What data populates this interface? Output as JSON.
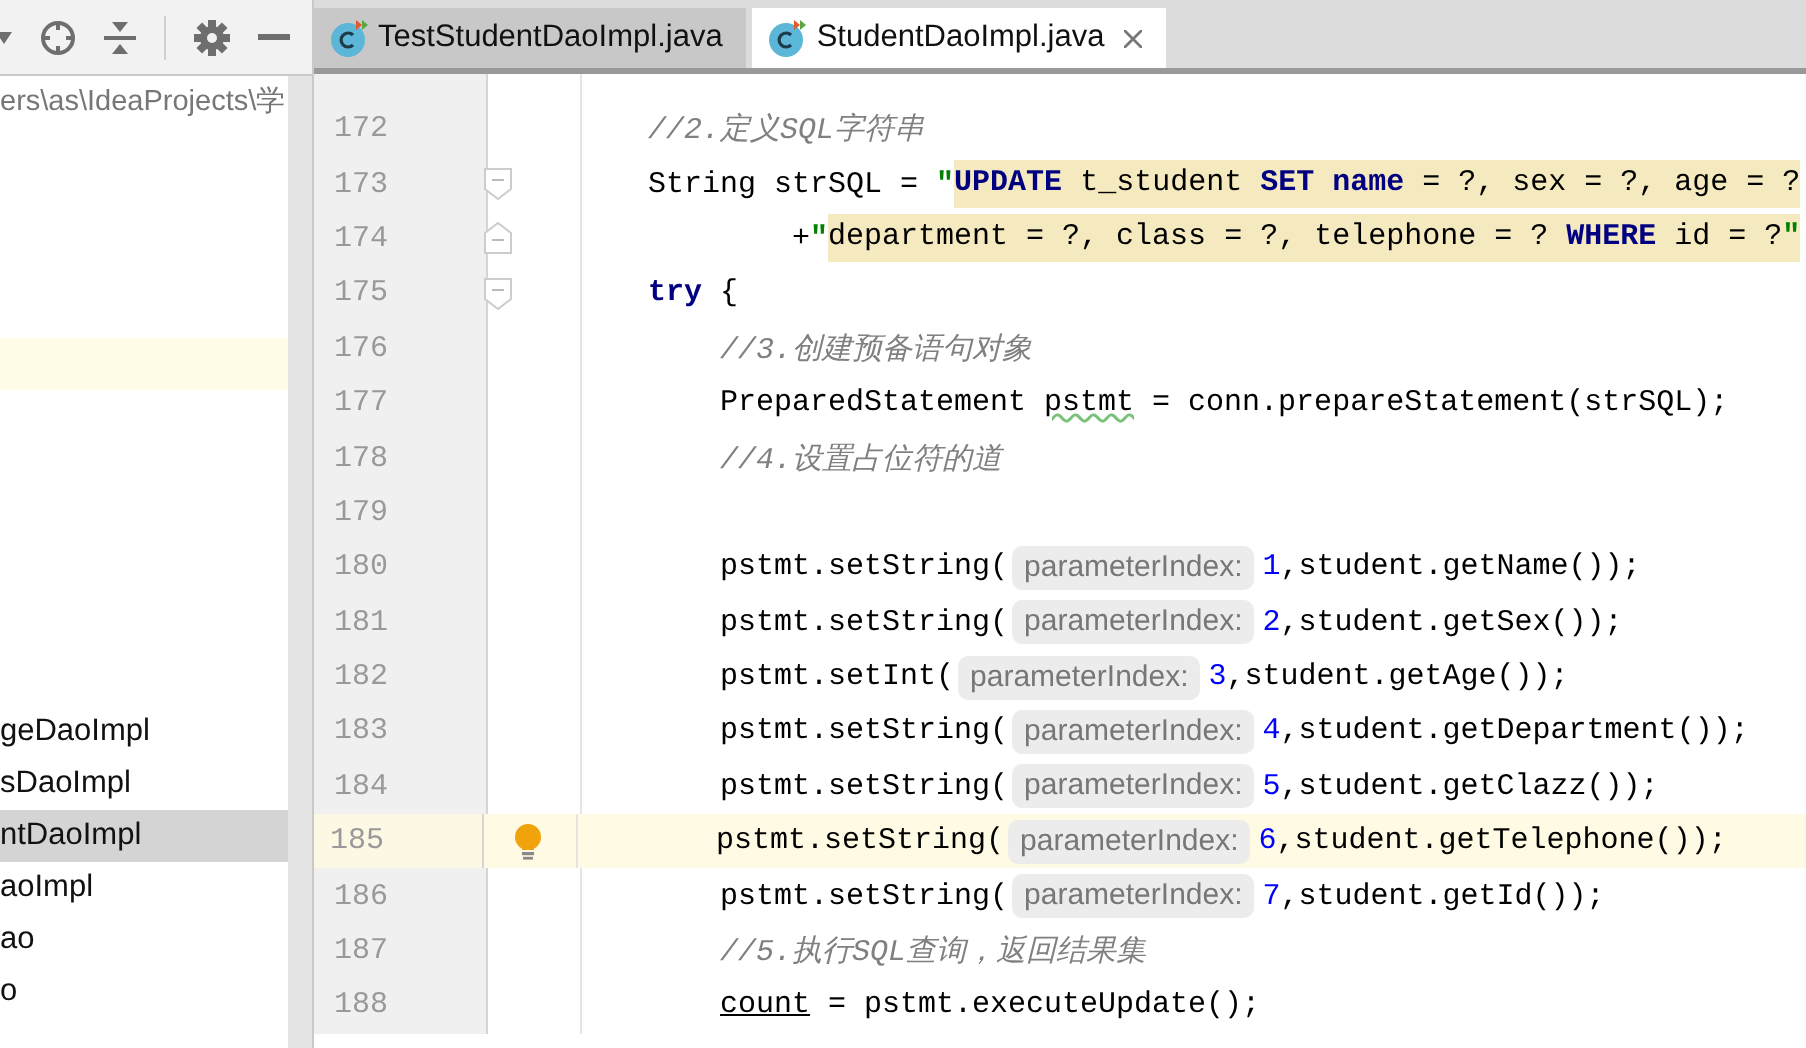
{
  "project_panel": {
    "path": "ers\\as\\IdeaProjects\\学",
    "items": [
      {
        "label": "geDaoImpl",
        "selected": false
      },
      {
        "label": "sDaoImpl",
        "selected": false
      },
      {
        "label": "ntDaoImpl",
        "selected": true
      },
      {
        "label": "aoImpl",
        "selected": false
      },
      {
        "label": "ao",
        "selected": false
      },
      {
        "label": "o",
        "selected": false
      }
    ]
  },
  "tabs": [
    {
      "label": "TestStudentDaoImpl.java",
      "selected": false
    },
    {
      "label": "StudentDaoImpl.java",
      "selected": true
    }
  ],
  "editor": {
    "lines": [
      {
        "number": "172",
        "tokens": [
          {
            "kind": "comment",
            "text": "//2.定义SQL字符串"
          }
        ]
      },
      {
        "number": "173",
        "fold_start": true,
        "tokens": [
          {
            "kind": "plain",
            "text": "String strSQL = "
          },
          {
            "kind": "string",
            "text": "\""
          },
          {
            "kind": "highlight",
            "tokens": [
              {
                "kind": "keyword",
                "text": "UPDATE"
              },
              {
                "kind": "plain",
                "text": " t_student "
              },
              {
                "kind": "keyword",
                "text": "SET name"
              },
              {
                "kind": "plain",
                "text": " = ?, sex = ?, age = ?"
              }
            ]
          }
        ]
      },
      {
        "number": "174",
        "fold_end": true,
        "kind": "continuation",
        "tokens": [
          {
            "kind": "plain",
            "text": "+"
          },
          {
            "kind": "string",
            "text": "\""
          },
          {
            "kind": "highlight",
            "tokens": [
              {
                "kind": "plain",
                "text": "department = ?, class = ?, telephone = ? "
              },
              {
                "kind": "keyword",
                "text": "WHERE"
              },
              {
                "kind": "plain",
                "text": " id = ?"
              },
              {
                "kind": "string",
                "text": "\""
              }
            ]
          }
        ]
      },
      {
        "number": "175",
        "fold_start": true,
        "tokens": [
          {
            "kind": "keyword",
            "text": "try"
          },
          {
            "kind": "plain",
            "text": " {"
          }
        ],
        "children": [
          {
            "number": "176",
            "tokens": [
              {
                "kind": "comment",
                "text": "//3.创建预备语句对象"
              }
            ]
          },
          {
            "number": "177",
            "tokens": [
              {
                "kind": "plain",
                "text": "PreparedStatement "
              },
              {
                "kind": "warning",
                "text": "pstmt"
              },
              {
                "kind": "plain",
                "text": " = conn.prepareStatement(strSQL);"
              }
            ]
          },
          {
            "number": "178",
            "tokens": [
              {
                "kind": "comment",
                "text": "//4.设置占位符的道"
              }
            ]
          },
          {
            "number": "179"
          },
          {
            "number": "180",
            "tokens": [
              {
                "kind": "plain",
                "text": "pstmt.setString("
              },
              {
                "kind": "hint",
                "text": "parameterIndex:"
              },
              {
                "kind": "number",
                "text": "1"
              },
              {
                "kind": "plain",
                "text": ",student.getName());"
              }
            ]
          },
          {
            "number": "181",
            "tokens": [
              {
                "kind": "plain",
                "text": "pstmt.setString("
              },
              {
                "kind": "hint",
                "text": "parameterIndex:"
              },
              {
                "kind": "number",
                "text": "2"
              },
              {
                "kind": "plain",
                "text": ",student.getSex());"
              }
            ]
          },
          {
            "number": "182",
            "tokens": [
              {
                "kind": "plain",
                "text": "pstmt.setInt("
              },
              {
                "kind": "hint",
                "text": "parameterIndex:"
              },
              {
                "kind": "number",
                "text": "3"
              },
              {
                "kind": "plain",
                "text": ",student.getAge());"
              }
            ]
          },
          {
            "number": "183",
            "tokens": [
              {
                "kind": "plain",
                "text": "pstmt.setString("
              },
              {
                "kind": "hint",
                "text": "parameterIndex:"
              },
              {
                "kind": "number",
                "text": "4"
              },
              {
                "kind": "plain",
                "text": ",student.getDepartment());"
              }
            ]
          },
          {
            "number": "184",
            "tokens": [
              {
                "kind": "plain",
                "text": "pstmt.setString("
              },
              {
                "kind": "hint",
                "text": "parameterIndex:"
              },
              {
                "kind": "number",
                "text": "5"
              },
              {
                "kind": "plain",
                "text": ",student.getClazz());"
              }
            ]
          },
          {
            "number": "185",
            "caret_line": true,
            "bulb": true,
            "tokens": [
              {
                "kind": "plain",
                "text": "pstmt.setString("
              },
              {
                "kind": "hint",
                "text": "parameterIndex:"
              },
              {
                "kind": "number",
                "text": "6"
              },
              {
                "kind": "plain",
                "text": ",student.getTelephone());"
              }
            ]
          },
          {
            "number": "186",
            "tokens": [
              {
                "kind": "plain",
                "text": "pstmt.setString("
              },
              {
                "kind": "hint",
                "text": "parameterIndex:"
              },
              {
                "kind": "number",
                "text": "7"
              },
              {
                "kind": "plain",
                "text": ",student.getId());"
              }
            ]
          },
          {
            "number": "187",
            "tokens": [
              {
                "kind": "comment",
                "text": "//5.执行SQL查询，返回结果集"
              }
            ]
          },
          {
            "number": "188",
            "tokens": [
              {
                "kind": "underlined",
                "text": "count"
              },
              {
                "kind": "plain",
                "text": " = pstmt.executeUpdate();"
              }
            ]
          }
        ]
      }
    ]
  }
}
